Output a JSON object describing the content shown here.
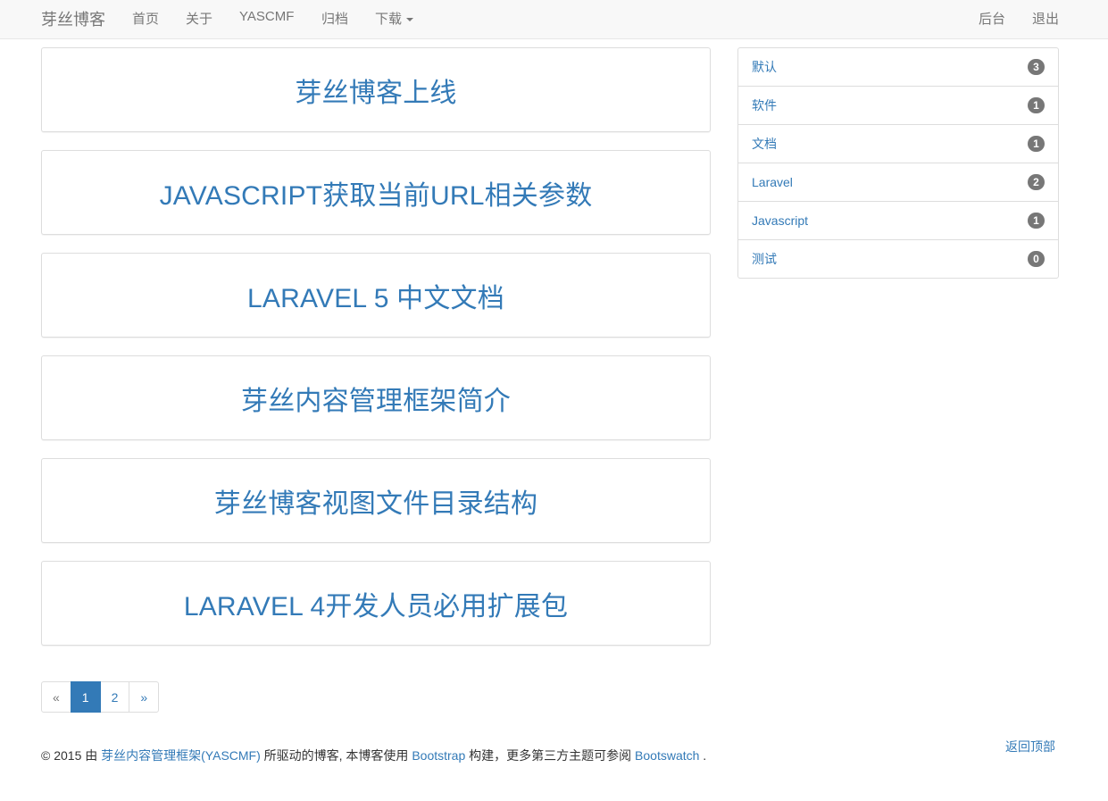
{
  "navbar": {
    "brand": "芽丝博客",
    "items": [
      {
        "label": "首页"
      },
      {
        "label": "关于"
      },
      {
        "label": "YASCMF"
      },
      {
        "label": "归档"
      },
      {
        "label": "下载"
      }
    ],
    "right_items": [
      {
        "label": "后台"
      },
      {
        "label": "退出"
      }
    ]
  },
  "posts": [
    {
      "title": "芽丝博客上线"
    },
    {
      "title": "JAVASCRIPT获取当前URL相关参数"
    },
    {
      "title": "LARAVEL 5 中文文档"
    },
    {
      "title": "芽丝内容管理框架简介"
    },
    {
      "title": "芽丝博客视图文件目录结构"
    },
    {
      "title": "LARAVEL 4开发人员必用扩展包"
    }
  ],
  "categories": [
    {
      "label": "默认",
      "count": "3"
    },
    {
      "label": "软件",
      "count": "1"
    },
    {
      "label": "文档",
      "count": "1"
    },
    {
      "label": "Laravel",
      "count": "2"
    },
    {
      "label": "Javascript",
      "count": "1"
    },
    {
      "label": "测试",
      "count": "0"
    }
  ],
  "pagination": {
    "prev": "«",
    "pages": [
      "1",
      "2"
    ],
    "active": "1",
    "next": "»"
  },
  "footer": {
    "prefix": "© 2015 由 ",
    "link1": "芽丝内容管理框架(YASCMF)",
    "middle": " 所驱动的博客, 本博客使用 ",
    "link2": "Bootstrap",
    "middle2": " 构建，更多第三方主题可参阅 ",
    "link3": "Bootswatch",
    "suffix": " .",
    "back_to_top": "返回顶部"
  },
  "colors": {
    "link": "#337ab7",
    "navbar_bg": "#f8f8f8",
    "badge_bg": "#777777",
    "border": "#dddddd"
  }
}
